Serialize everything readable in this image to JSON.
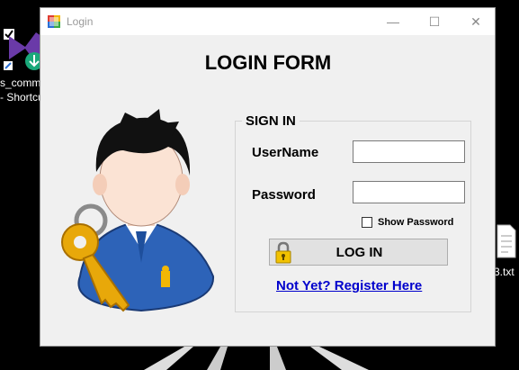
{
  "desktop": {
    "shortcut_label_line1": "s_comm",
    "shortcut_label_line2": "- Shortcu",
    "file_label": "3.txt"
  },
  "window": {
    "title": "Login",
    "minimize_symbol": "—",
    "maximize_symbol": "☐",
    "close_symbol": "✕"
  },
  "form": {
    "title": "LOGIN FORM",
    "group_label": "SIGN IN",
    "username_label": "UserName",
    "username_value": "",
    "password_label": "Password",
    "password_value": "",
    "show_password_label": "Show Password",
    "show_password_checked": false,
    "login_button_label": "LOG IN",
    "register_link_label": "Not Yet? Register Here"
  },
  "icons": {
    "app": "app-window-icon",
    "user": "user-with-key-icon",
    "lock": "padlock-icon"
  },
  "colors": {
    "window_bg": "#f0f0f0",
    "link": "#0000cc",
    "button_bg": "#e1e1e1"
  }
}
